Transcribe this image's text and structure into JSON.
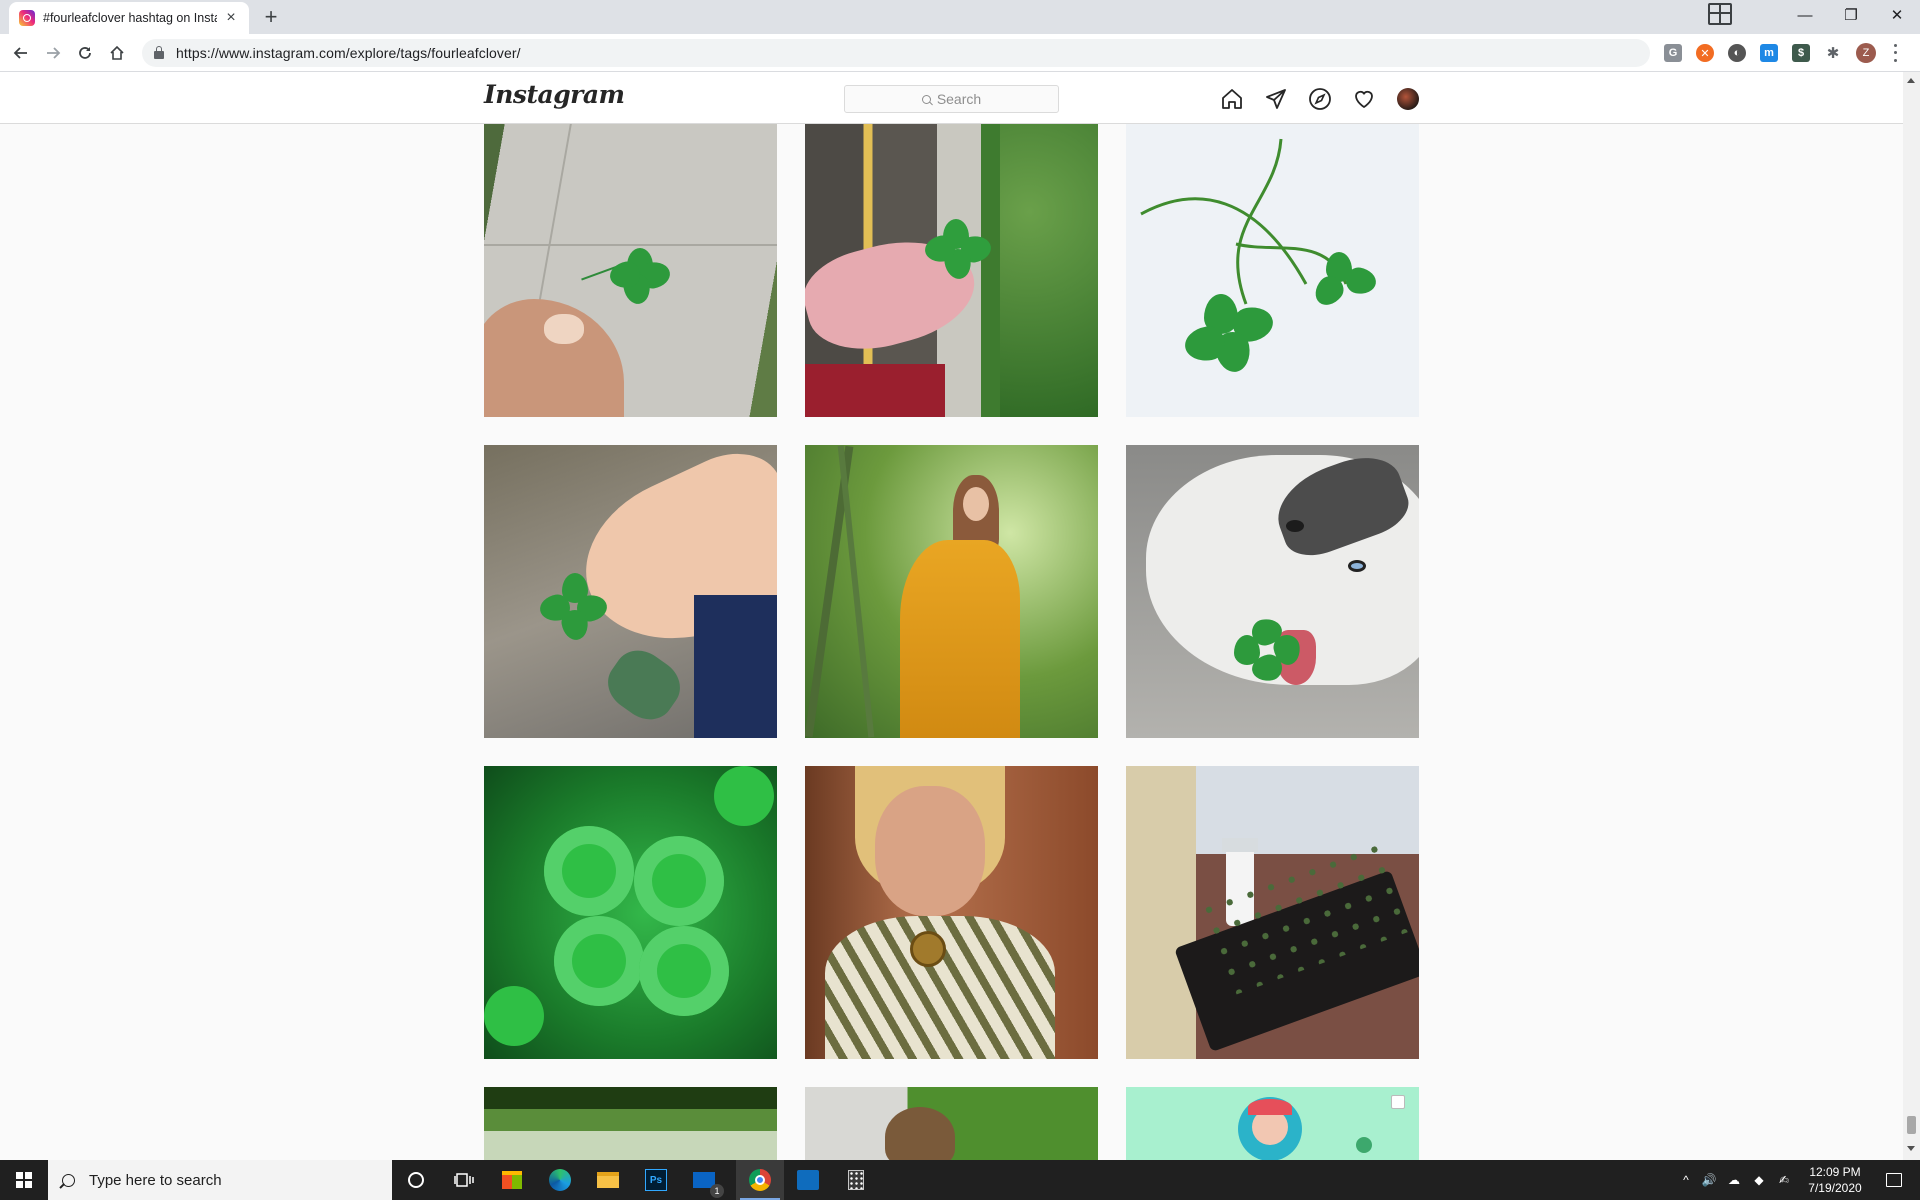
{
  "browser": {
    "tab_title": "#fourleafclover hashtag on Insta",
    "new_tab_label": "+",
    "close_tab_label": "×",
    "url": "https://www.instagram.com/explore/tags/fourleafclover/",
    "window_controls": {
      "minimize": "—",
      "restore": "❐",
      "close": "✕"
    },
    "extensions": [
      {
        "name": "grammarly-extension-icon",
        "label": "G",
        "color": "#8a8f96"
      },
      {
        "name": "honey-extension-icon",
        "label": "✕",
        "color": "#f26c22"
      },
      {
        "name": "dark-reader-extension-icon",
        "label": "◐",
        "color": "#555555"
      },
      {
        "name": "m-extension-icon",
        "label": "m",
        "color": "#1e88e5"
      },
      {
        "name": "s-extension-icon",
        "label": "$",
        "color": "#3e5a4c"
      },
      {
        "name": "puzzle-extension-icon",
        "label": "✱",
        "color": "#5f6368"
      }
    ],
    "profile_initial": "Z"
  },
  "instagram": {
    "logo_text": "Instagram",
    "search_placeholder": "Search",
    "nav_icons": [
      "home-icon",
      "direct-messages-icon",
      "explore-icon",
      "activity-heart-icon",
      "profile-avatar"
    ]
  },
  "posts": [
    {
      "name": "post-clover-on-sidewalk",
      "motif": "hand-clover",
      "bg": "sidewalk"
    },
    {
      "name": "post-clover-by-curb",
      "motif": "hand-clover",
      "bg": "curb"
    },
    {
      "name": "post-clover-stems-white",
      "motif": "stems",
      "bg": "white"
    },
    {
      "name": "post-clover-over-shoes",
      "motif": "hand-clover",
      "bg": "asphalt"
    },
    {
      "name": "post-woman-yellow-dress",
      "motif": "portrait",
      "bg": "forest"
    },
    {
      "name": "post-husky-with-clover",
      "motif": "husky",
      "bg": "husky"
    },
    {
      "name": "post-clover-patch",
      "motif": "patch",
      "bg": "patch"
    },
    {
      "name": "post-woman-clover-necklace",
      "motif": "selfie",
      "bg": "selfie"
    },
    {
      "name": "post-potted-clover-spray",
      "motif": "planter",
      "bg": "table"
    },
    {
      "name": "post-park-trees",
      "motif": "park",
      "bg": "park"
    },
    {
      "name": "post-cat-in-grass",
      "motif": "cat",
      "bg": "grass"
    },
    {
      "name": "post-illustration-girl",
      "motif": "illustration",
      "bg": "mint"
    }
  ],
  "taskbar": {
    "search_placeholder": "Type here to search",
    "mail_badge": "1",
    "time": "12:09 PM",
    "date": "7/19/2020"
  }
}
